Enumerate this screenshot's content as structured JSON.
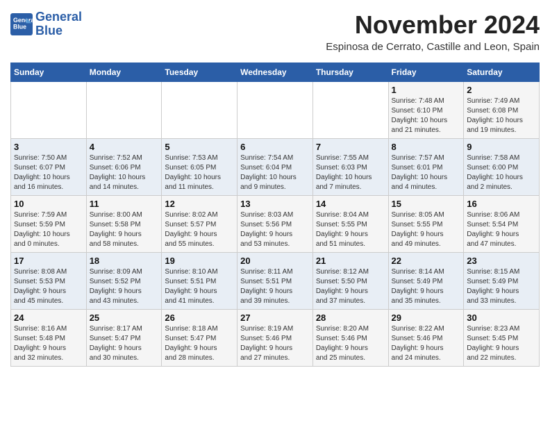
{
  "logo": {
    "line1": "General",
    "line2": "Blue"
  },
  "title": "November 2024",
  "subtitle": "Espinosa de Cerrato, Castille and Leon, Spain",
  "headers": [
    "Sunday",
    "Monday",
    "Tuesday",
    "Wednesday",
    "Thursday",
    "Friday",
    "Saturday"
  ],
  "weeks": [
    [
      {
        "day": "",
        "info": ""
      },
      {
        "day": "",
        "info": ""
      },
      {
        "day": "",
        "info": ""
      },
      {
        "day": "",
        "info": ""
      },
      {
        "day": "",
        "info": ""
      },
      {
        "day": "1",
        "info": "Sunrise: 7:48 AM\nSunset: 6:10 PM\nDaylight: 10 hours\nand 21 minutes."
      },
      {
        "day": "2",
        "info": "Sunrise: 7:49 AM\nSunset: 6:08 PM\nDaylight: 10 hours\nand 19 minutes."
      }
    ],
    [
      {
        "day": "3",
        "info": "Sunrise: 7:50 AM\nSunset: 6:07 PM\nDaylight: 10 hours\nand 16 minutes."
      },
      {
        "day": "4",
        "info": "Sunrise: 7:52 AM\nSunset: 6:06 PM\nDaylight: 10 hours\nand 14 minutes."
      },
      {
        "day": "5",
        "info": "Sunrise: 7:53 AM\nSunset: 6:05 PM\nDaylight: 10 hours\nand 11 minutes."
      },
      {
        "day": "6",
        "info": "Sunrise: 7:54 AM\nSunset: 6:04 PM\nDaylight: 10 hours\nand 9 minutes."
      },
      {
        "day": "7",
        "info": "Sunrise: 7:55 AM\nSunset: 6:03 PM\nDaylight: 10 hours\nand 7 minutes."
      },
      {
        "day": "8",
        "info": "Sunrise: 7:57 AM\nSunset: 6:01 PM\nDaylight: 10 hours\nand 4 minutes."
      },
      {
        "day": "9",
        "info": "Sunrise: 7:58 AM\nSunset: 6:00 PM\nDaylight: 10 hours\nand 2 minutes."
      }
    ],
    [
      {
        "day": "10",
        "info": "Sunrise: 7:59 AM\nSunset: 5:59 PM\nDaylight: 10 hours\nand 0 minutes."
      },
      {
        "day": "11",
        "info": "Sunrise: 8:00 AM\nSunset: 5:58 PM\nDaylight: 9 hours\nand 58 minutes."
      },
      {
        "day": "12",
        "info": "Sunrise: 8:02 AM\nSunset: 5:57 PM\nDaylight: 9 hours\nand 55 minutes."
      },
      {
        "day": "13",
        "info": "Sunrise: 8:03 AM\nSunset: 5:56 PM\nDaylight: 9 hours\nand 53 minutes."
      },
      {
        "day": "14",
        "info": "Sunrise: 8:04 AM\nSunset: 5:55 PM\nDaylight: 9 hours\nand 51 minutes."
      },
      {
        "day": "15",
        "info": "Sunrise: 8:05 AM\nSunset: 5:55 PM\nDaylight: 9 hours\nand 49 minutes."
      },
      {
        "day": "16",
        "info": "Sunrise: 8:06 AM\nSunset: 5:54 PM\nDaylight: 9 hours\nand 47 minutes."
      }
    ],
    [
      {
        "day": "17",
        "info": "Sunrise: 8:08 AM\nSunset: 5:53 PM\nDaylight: 9 hours\nand 45 minutes."
      },
      {
        "day": "18",
        "info": "Sunrise: 8:09 AM\nSunset: 5:52 PM\nDaylight: 9 hours\nand 43 minutes."
      },
      {
        "day": "19",
        "info": "Sunrise: 8:10 AM\nSunset: 5:51 PM\nDaylight: 9 hours\nand 41 minutes."
      },
      {
        "day": "20",
        "info": "Sunrise: 8:11 AM\nSunset: 5:51 PM\nDaylight: 9 hours\nand 39 minutes."
      },
      {
        "day": "21",
        "info": "Sunrise: 8:12 AM\nSunset: 5:50 PM\nDaylight: 9 hours\nand 37 minutes."
      },
      {
        "day": "22",
        "info": "Sunrise: 8:14 AM\nSunset: 5:49 PM\nDaylight: 9 hours\nand 35 minutes."
      },
      {
        "day": "23",
        "info": "Sunrise: 8:15 AM\nSunset: 5:49 PM\nDaylight: 9 hours\nand 33 minutes."
      }
    ],
    [
      {
        "day": "24",
        "info": "Sunrise: 8:16 AM\nSunset: 5:48 PM\nDaylight: 9 hours\nand 32 minutes."
      },
      {
        "day": "25",
        "info": "Sunrise: 8:17 AM\nSunset: 5:47 PM\nDaylight: 9 hours\nand 30 minutes."
      },
      {
        "day": "26",
        "info": "Sunrise: 8:18 AM\nSunset: 5:47 PM\nDaylight: 9 hours\nand 28 minutes."
      },
      {
        "day": "27",
        "info": "Sunrise: 8:19 AM\nSunset: 5:46 PM\nDaylight: 9 hours\nand 27 minutes."
      },
      {
        "day": "28",
        "info": "Sunrise: 8:20 AM\nSunset: 5:46 PM\nDaylight: 9 hours\nand 25 minutes."
      },
      {
        "day": "29",
        "info": "Sunrise: 8:22 AM\nSunset: 5:46 PM\nDaylight: 9 hours\nand 24 minutes."
      },
      {
        "day": "30",
        "info": "Sunrise: 8:23 AM\nSunset: 5:45 PM\nDaylight: 9 hours\nand 22 minutes."
      }
    ]
  ]
}
